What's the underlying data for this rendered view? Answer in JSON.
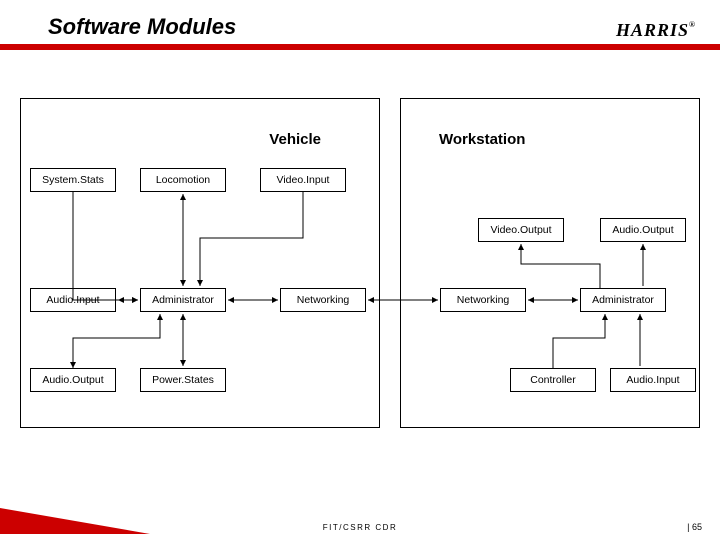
{
  "slide": {
    "title": "Software Modules",
    "brand": "HARRIS"
  },
  "vehicle": {
    "title": "Vehicle",
    "modules": {
      "systemStats": "System.Stats",
      "locomotion": "Locomotion",
      "videoInput": "Video.Input",
      "audioInput": "Audio.Input",
      "administrator": "Administrator",
      "networking": "Networking",
      "audioOutput": "Audio.Output",
      "powerStates": "Power.States"
    }
  },
  "workstation": {
    "title": "Workstation",
    "modules": {
      "videoOutput": "Video.Output",
      "audioOutput": "Audio.Output",
      "networking": "Networking",
      "administrator": "Administrator",
      "controller": "Controller",
      "audioInput": "Audio.Input"
    }
  },
  "footer": {
    "center": "FIT/CSRR CDR",
    "page": "| 65"
  },
  "chart_data": {
    "type": "table",
    "title": "Software Modules",
    "panels": [
      {
        "name": "Vehicle",
        "nodes": [
          "System.Stats",
          "Locomotion",
          "Video.Input",
          "Audio.Input",
          "Administrator",
          "Networking",
          "Audio.Output",
          "Power.States"
        ],
        "edges": [
          [
            "System.Stats",
            "Administrator",
            "uni"
          ],
          [
            "Locomotion",
            "Administrator",
            "bi"
          ],
          [
            "Video.Input",
            "Administrator",
            "uni"
          ],
          [
            "Audio.Input",
            "Administrator",
            "bi"
          ],
          [
            "Audio.Output",
            "Administrator",
            "bi"
          ],
          [
            "Power.States",
            "Administrator",
            "bi"
          ],
          [
            "Administrator",
            "Networking",
            "bi"
          ]
        ]
      },
      {
        "name": "Workstation",
        "nodes": [
          "Video.Output",
          "Audio.Output",
          "Networking",
          "Administrator",
          "Controller",
          "Audio.Input"
        ],
        "edges": [
          [
            "Networking",
            "Administrator",
            "bi"
          ],
          [
            "Administrator",
            "Video.Output",
            "uni"
          ],
          [
            "Administrator",
            "Audio.Output",
            "uni"
          ],
          [
            "Controller",
            "Administrator",
            "uni"
          ],
          [
            "Audio.Input",
            "Administrator",
            "uni"
          ]
        ]
      }
    ],
    "crossEdges": [
      [
        "Vehicle.Networking",
        "Workstation.Networking",
        "bi"
      ]
    ]
  }
}
